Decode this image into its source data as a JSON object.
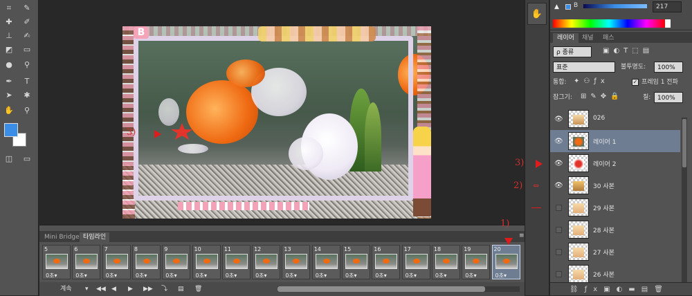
{
  "tools": {
    "icons": [
      "crop-icon",
      "eyedropper-icon",
      "healing-brush-icon",
      "brush-icon",
      "clone-stamp-icon",
      "history-brush-icon",
      "eraser-icon",
      "gradient-icon",
      "blur-icon",
      "dodge-icon",
      "pen-icon",
      "text-icon",
      "path-select-icon",
      "shape-icon",
      "hand-icon",
      "zoom-icon",
      "quick-mask-icon",
      "screen-mode-icon"
    ],
    "glyphs": [
      "⌗",
      "✎",
      "✚",
      "✐",
      "⊥",
      "✍",
      "◩",
      "▭",
      "●",
      "⚲",
      "✒",
      "T",
      "➤",
      "✱",
      "✋",
      "⚲",
      "◫",
      "▭"
    ],
    "foreground_color": "#3a8ee6",
    "background_color": "#ffffff"
  },
  "canvas": {
    "annotation_3": "3)",
    "logo_letter": "B"
  },
  "color_panel": {
    "channel_label": "B",
    "channel_value": "217"
  },
  "layers_panel": {
    "tabs": [
      "레이어",
      "채널",
      "패스"
    ],
    "filter_kind": "ρ 종류",
    "blend_mode": "표준",
    "opacity_label": "불투명도:",
    "opacity_value": "100%",
    "unify_label": "통합:",
    "propagate_label": "프레임 1 전파",
    "lock_label": "잠그기:",
    "fill_label": "칠:",
    "fill_value": "100%",
    "layers": [
      {
        "name": "026",
        "visible": true,
        "selected": false
      },
      {
        "name": "레이어 1",
        "visible": true,
        "selected": true
      },
      {
        "name": "레이어 2",
        "visible": true,
        "selected": false
      },
      {
        "name": "30 사본",
        "visible": true,
        "selected": false
      },
      {
        "name": "29 사본",
        "visible": false,
        "selected": false
      },
      {
        "name": "28 사본",
        "visible": false,
        "selected": false
      },
      {
        "name": "27 사본",
        "visible": false,
        "selected": false
      },
      {
        "name": "26 사본",
        "visible": false,
        "selected": false
      }
    ],
    "footer_icons": [
      "link-icon",
      "fx-icon",
      "mask-icon",
      "adjustment-icon",
      "folder-icon",
      "new-layer-icon",
      "trash-icon"
    ],
    "annotations": {
      "a3": "3)",
      "a2": "2)"
    }
  },
  "timeline": {
    "tabs": [
      "Mini Bridge",
      "타임라인"
    ],
    "annotation_1": "1)",
    "frames": [
      {
        "num": "5",
        "delay": "0초▾"
      },
      {
        "num": "6",
        "delay": "0초▾"
      },
      {
        "num": "7",
        "delay": "0초▾"
      },
      {
        "num": "8",
        "delay": "0초▾"
      },
      {
        "num": "9",
        "delay": "0초▾"
      },
      {
        "num": "10",
        "delay": "0초▾"
      },
      {
        "num": "11",
        "delay": "0초▾"
      },
      {
        "num": "12",
        "delay": "0초▾"
      },
      {
        "num": "13",
        "delay": "0초▾"
      },
      {
        "num": "14",
        "delay": "0초▾"
      },
      {
        "num": "15",
        "delay": "0초▾"
      },
      {
        "num": "16",
        "delay": "0초▾"
      },
      {
        "num": "17",
        "delay": "0초▾"
      },
      {
        "num": "18",
        "delay": "0초▾"
      },
      {
        "num": "19",
        "delay": "0초▾"
      },
      {
        "num": "20",
        "delay": "0초▾"
      }
    ],
    "loop_label": "계속",
    "selected_frame": "20"
  }
}
